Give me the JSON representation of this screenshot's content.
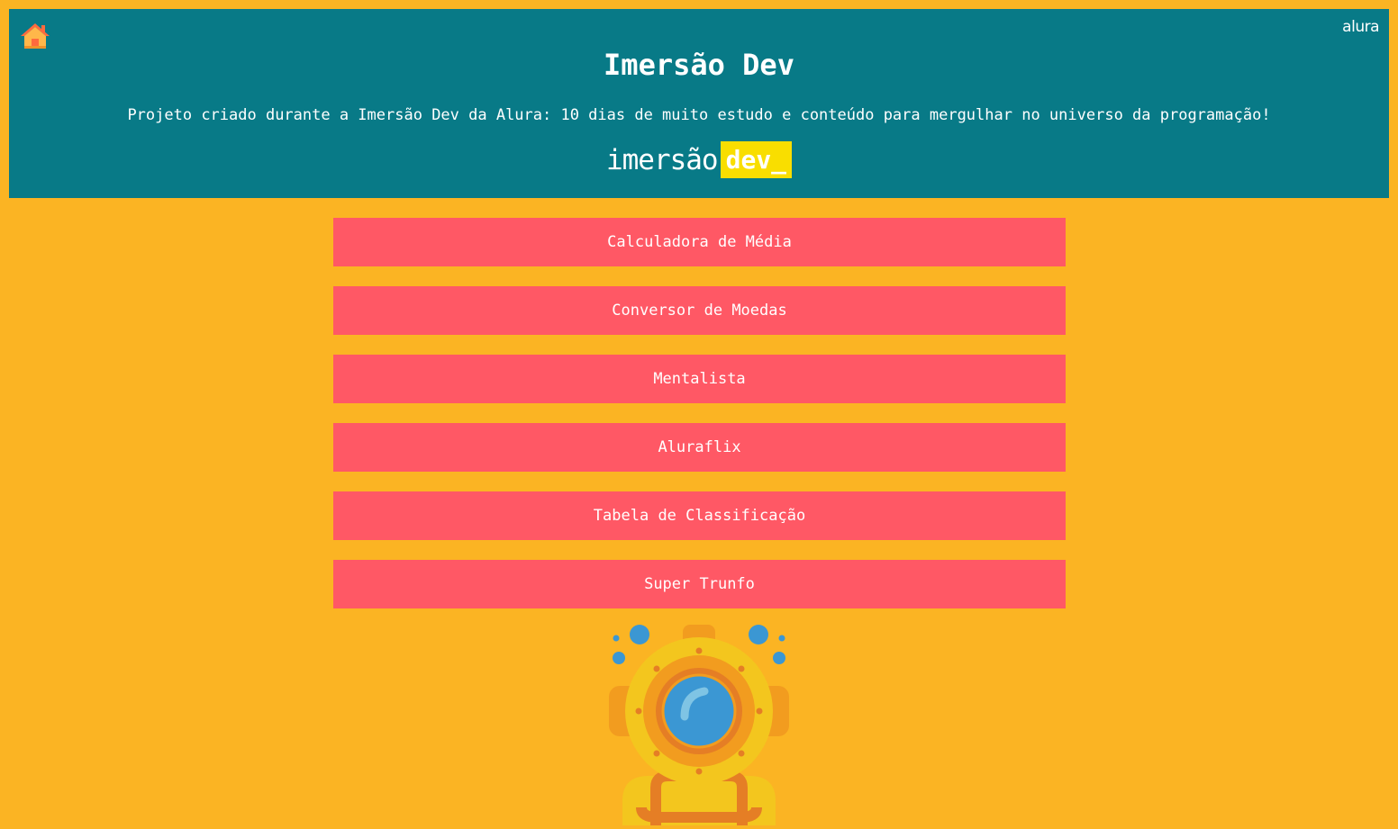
{
  "header": {
    "home_icon": "home-icon",
    "alura_logo": "alura",
    "title": "Imersão Dev",
    "subtitle": "Projeto criado durante a Imersão Dev da Alura: 10 dias de muito estudo e conteúdo para mergulhar no universo da programação!",
    "brand_word": "imersão",
    "brand_tag": "dev_"
  },
  "nav": {
    "items": [
      {
        "label": "Calculadora de Média"
      },
      {
        "label": "Conversor de Moedas"
      },
      {
        "label": "Mentalista"
      },
      {
        "label": "Aluraflix"
      },
      {
        "label": "Tabela de Classificação"
      },
      {
        "label": "Super Trunfo"
      }
    ]
  },
  "illustration": {
    "icon": "diving-helmet-icon"
  },
  "colors": {
    "background": "#FBB423",
    "header": "#087A87",
    "button": "#FF5865",
    "brand_highlight": "#F9DE00"
  }
}
